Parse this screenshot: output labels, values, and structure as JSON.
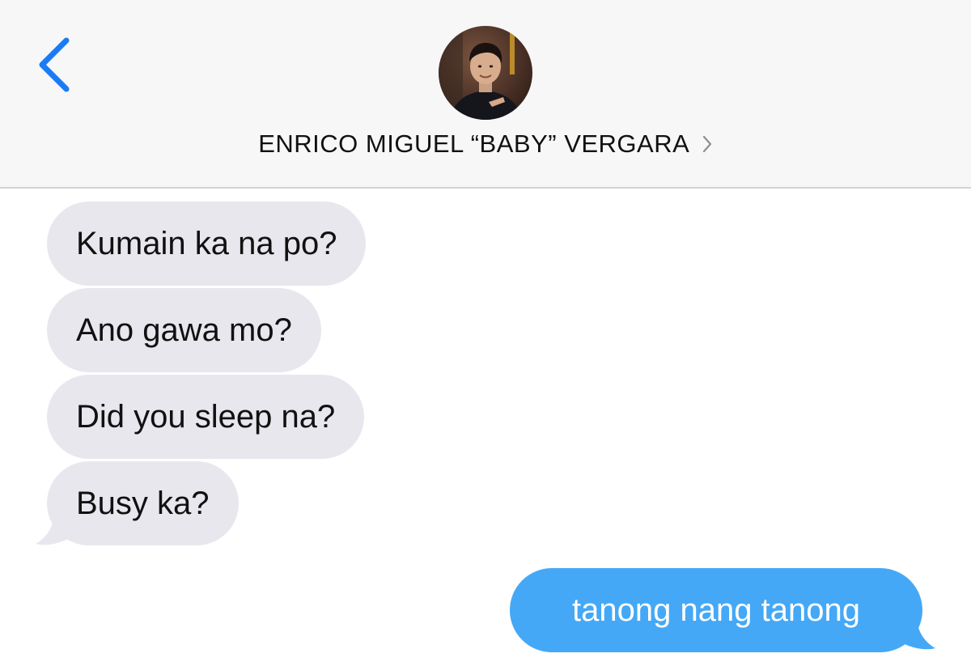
{
  "header": {
    "back_icon": "chevron-left-icon",
    "avatar_icon": "contact-avatar",
    "contact_name": "ENRICO MIGUEL “BABY” VERGARA",
    "details_icon": "chevron-right-icon"
  },
  "messages": [
    {
      "direction": "incoming",
      "text": "Kumain ka na po?"
    },
    {
      "direction": "incoming",
      "text": "Ano gawa mo?"
    },
    {
      "direction": "incoming",
      "text": "Did you sleep na?"
    },
    {
      "direction": "incoming",
      "text": "Busy ka?"
    },
    {
      "direction": "outgoing",
      "text": "tanong nang tanong"
    }
  ],
  "colors": {
    "accent": "#1a7cf5",
    "incoming_bubble": "#e8e7ed",
    "outgoing_bubble": "#44a8f6",
    "header_bg": "#f7f7f7"
  }
}
